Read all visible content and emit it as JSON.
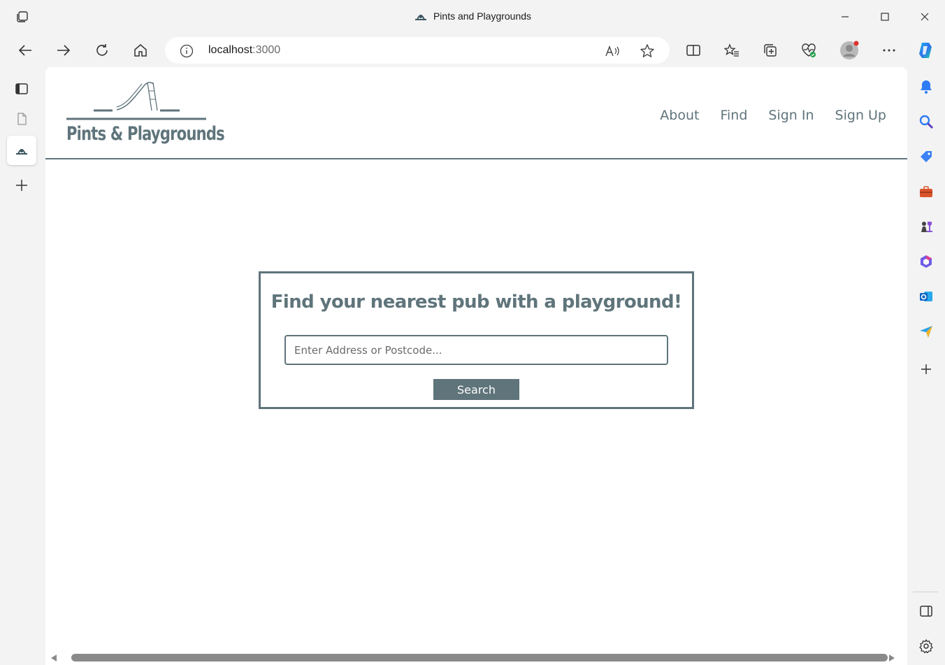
{
  "browser": {
    "window_title": "Pints and Playgrounds",
    "address": {
      "host": "localhost",
      "port": ":3000"
    },
    "colors": {
      "chrome_bg": "#f3f3f3",
      "accent_blue": "#1a73e8"
    }
  },
  "site": {
    "logo_text": "Pints & Playgrounds",
    "nav": [
      "About",
      "Find",
      "Sign In",
      "Sign Up"
    ],
    "colors": {
      "brand": "#5f747b",
      "background": "#ffffff"
    }
  },
  "search": {
    "heading": "Find your nearest pub with a playground!",
    "placeholder": "Enter Address or Postcode...",
    "value": "",
    "button_label": "Search"
  }
}
